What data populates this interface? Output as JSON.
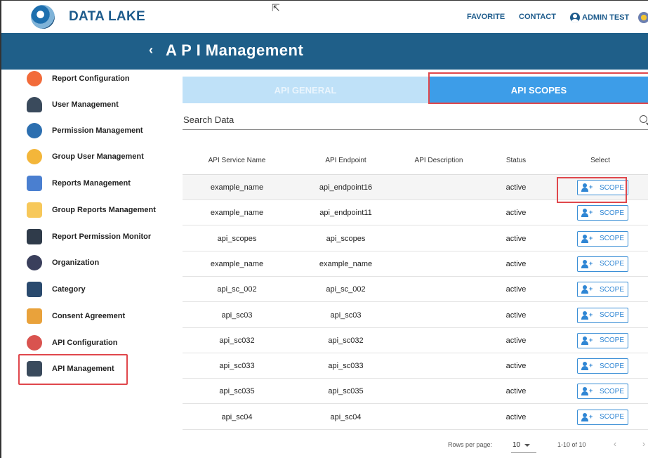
{
  "header": {
    "brand": "DATA LAKE",
    "nav_favorite": "FAVORITE",
    "nav_contact": "CONTACT",
    "nav_admin": "ADMIN TEST"
  },
  "title_bar": {
    "back": "‹",
    "title": "A P I Management"
  },
  "sidebar": {
    "items": [
      {
        "label": "Report Configuration",
        "icon": "report-configuration-icon",
        "color": "#f26b3a"
      },
      {
        "label": "User Management",
        "icon": "user-management-icon",
        "color": "#3a4a5c"
      },
      {
        "label": "Permission Management",
        "icon": "permission-management-icon",
        "color": "#2c6fb0"
      },
      {
        "label": "Group User Management",
        "icon": "group-user-icon",
        "color": "#f3b63a"
      },
      {
        "label": "Reports Management",
        "icon": "reports-management-icon",
        "color": "#4a7fd0"
      },
      {
        "label": "Group Reports Management",
        "icon": "folder-icon",
        "color": "#f7c85a"
      },
      {
        "label": "Report Permission Monitor",
        "icon": "monitor-icon",
        "color": "#2f3b4a"
      },
      {
        "label": "Organization",
        "icon": "organization-icon",
        "color": "#3a3f5c"
      },
      {
        "label": "Category",
        "icon": "category-icon",
        "color": "#2a4a6e"
      },
      {
        "label": "Consent Agreement",
        "icon": "consent-icon",
        "color": "#e9a23b"
      },
      {
        "label": "API Configuration",
        "icon": "api-configuration-icon",
        "color": "#d9534f"
      },
      {
        "label": "API Management",
        "icon": "api-management-icon",
        "color": "#3a4a5c"
      }
    ]
  },
  "tabs": {
    "general": "API GENERAL",
    "scopes": "API SCOPES"
  },
  "search": {
    "placeholder": "Search Data"
  },
  "table": {
    "headers": [
      "API Service Name",
      "API Endpoint",
      "API Description",
      "Status",
      "Select"
    ],
    "rows": [
      {
        "name": "example_name",
        "endpoint": "api_endpoint16",
        "description": "",
        "status": "active",
        "action": "SCOPE"
      },
      {
        "name": "example_name",
        "endpoint": "api_endpoint11",
        "description": "",
        "status": "active",
        "action": "SCOPE"
      },
      {
        "name": "api_scopes",
        "endpoint": "api_scopes",
        "description": "",
        "status": "active",
        "action": "SCOPE"
      },
      {
        "name": "example_name",
        "endpoint": "example_name",
        "description": "",
        "status": "active",
        "action": "SCOPE"
      },
      {
        "name": "api_sc_002",
        "endpoint": "api_sc_002",
        "description": "",
        "status": "active",
        "action": "SCOPE"
      },
      {
        "name": "api_sc03",
        "endpoint": "api_sc03",
        "description": "",
        "status": "active",
        "action": "SCOPE"
      },
      {
        "name": "api_sc032",
        "endpoint": "api_sc032",
        "description": "",
        "status": "active",
        "action": "SCOPE"
      },
      {
        "name": "api_sc033",
        "endpoint": "api_sc033",
        "description": "",
        "status": "active",
        "action": "SCOPE"
      },
      {
        "name": "api_sc035",
        "endpoint": "api_sc035",
        "description": "",
        "status": "active",
        "action": "SCOPE"
      },
      {
        "name": "api_sc04",
        "endpoint": "api_sc04",
        "description": "",
        "status": "active",
        "action": "SCOPE"
      }
    ]
  },
  "pagination": {
    "rows_per_page_label": "Rows per page:",
    "rows_per_page_value": "10",
    "range": "1-10 of 10",
    "prev": "‹",
    "next": "›"
  },
  "colors": {
    "brand": "#1d5b8c",
    "title_bar": "#1f5f89",
    "tab_active": "#3d9de8",
    "tab_inactive": "#bfe1f8",
    "highlight": "#e0474c",
    "button_accent": "#2f86d4"
  }
}
